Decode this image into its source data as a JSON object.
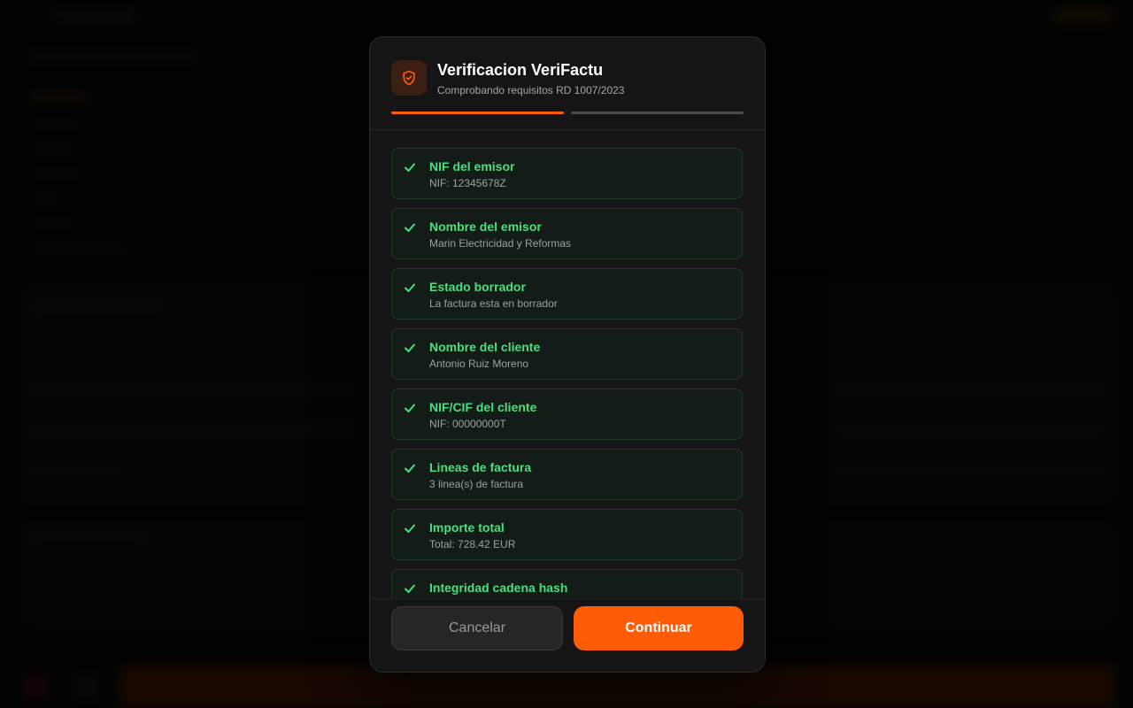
{
  "modal": {
    "title": "Verificacion VeriFactu",
    "subtitle": "Comprobando requisitos RD 1007/2023",
    "progress": {
      "steps_total": 2,
      "current_step": 1
    },
    "checks": [
      {
        "label": "NIF del emisor",
        "detail": "NIF: 12345678Z",
        "status": "ok"
      },
      {
        "label": "Nombre del emisor",
        "detail": "Marin Electricidad y Reformas",
        "status": "ok"
      },
      {
        "label": "Estado borrador",
        "detail": "La factura esta en borrador",
        "status": "ok"
      },
      {
        "label": "Nombre del cliente",
        "detail": "Antonio Ruiz Moreno",
        "status": "ok"
      },
      {
        "label": "NIF/CIF del cliente",
        "detail": "NIF: 00000000T",
        "status": "ok"
      },
      {
        "label": "Lineas de factura",
        "detail": "3 linea(s) de factura",
        "status": "ok"
      },
      {
        "label": "Importe total",
        "detail": "Total: 728.42 EUR",
        "status": "ok"
      },
      {
        "label": "Integridad cadena hash",
        "detail": "",
        "status": "ok"
      }
    ],
    "buttons": {
      "cancel": "Cancelar",
      "continue": "Continuar"
    }
  },
  "icons": {
    "header": "shield-check-icon",
    "check": "check-icon"
  },
  "colors": {
    "accent": "#ff5c0a",
    "success": "#4ade80",
    "background": "#050505",
    "surface": "#151515"
  }
}
